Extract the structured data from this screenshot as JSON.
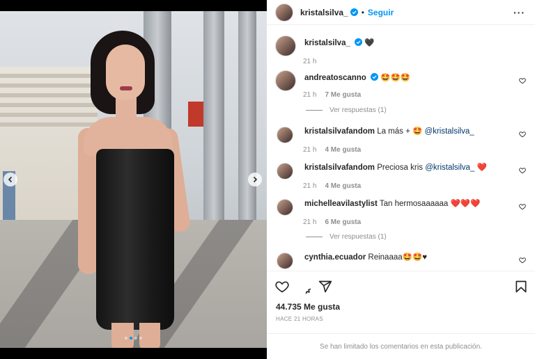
{
  "header": {
    "username": "kristalsilva_",
    "separator": "•",
    "follow_label": "Seguir",
    "more_label": "···"
  },
  "caption": {
    "username": "kristalsilva_",
    "text": "🖤",
    "time": "21 h"
  },
  "comments": [
    {
      "username": "andreatoscanno",
      "verified": true,
      "text": "🤩🤩🤩",
      "time": "21 h",
      "likes": "7 Me gusta",
      "replies": "Ver respuestas (1)"
    },
    {
      "username": "kristalsilvafandom",
      "text": "La más + 🤩 ",
      "mention": "@kristalsilva_",
      "suffix": "",
      "time": "21 h",
      "likes": "4 Me gusta"
    },
    {
      "username": "kristalsilvafandom",
      "text": "Preciosa kris ",
      "mention": "@kristalsilva_",
      "suffix": " ❤️",
      "time": "21 h",
      "likes": "4 Me gusta"
    },
    {
      "username": "michelleavilastylist",
      "text": "Tan hermosaaaaaa ❤️❤️❤️",
      "time": "21 h",
      "likes": "6 Me gusta",
      "replies": "Ver respuestas (1)"
    },
    {
      "username": "cynthia.ecuador",
      "text": "Reinaaaa🤩🤩♥"
    }
  ],
  "stats": {
    "likes": "44.735 Me gusta",
    "time_ago": "HACE 21 HORAS"
  },
  "footer": {
    "limited_text": "Se han limitado los comentarios en esta publicación."
  },
  "colors": {
    "accent": "#0095f6",
    "heart_red": "#ed4956",
    "muted": "#8e8e8e"
  }
}
